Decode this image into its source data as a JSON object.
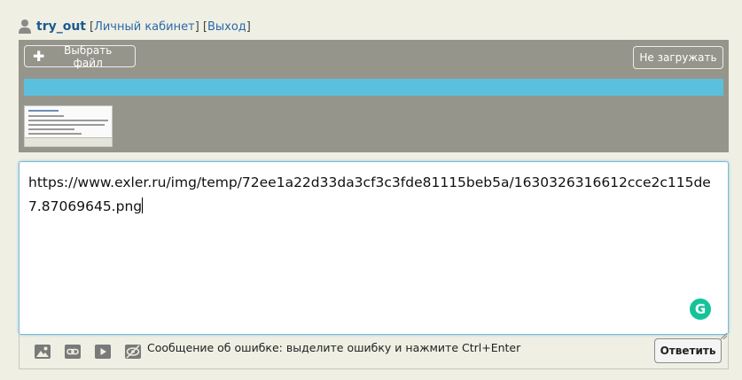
{
  "userbar": {
    "username": "try_out",
    "open_bracket": "[",
    "cabinet_label": "Личный кабинет",
    "separator": "] [",
    "logout_label": "Выход",
    "close_bracket": "]"
  },
  "upload": {
    "choose_file_label": "Выбрать файл",
    "no_upload_label": "Не загружать",
    "progress_fraction": 1.0,
    "progress_color": "#5bc0de",
    "panel_color": "#96958b"
  },
  "editor": {
    "value": "https://www.exler.ru/img/temp/72ee1a22d33da3cf3c3fde81115beb5a/1630326316612cce2c115de7.87069645.png",
    "grammarly_letter": "G",
    "grammarly_color": "#15c39a"
  },
  "toolbar": {
    "icons": [
      "image-icon",
      "link-icon",
      "video-icon",
      "hide-spoiler-icon"
    ],
    "hint_text": "Сообщение об ошибке: выделите ошибку и нажмите Ctrl+Enter",
    "reply_label": "Ответить"
  }
}
